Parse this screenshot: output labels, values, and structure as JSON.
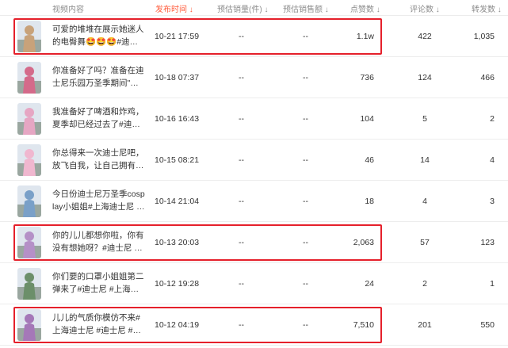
{
  "header": {
    "video_content": "视频内容",
    "publish_time": "发布时间",
    "est_sales": "预估销量(件)",
    "est_amount": "预估销售额",
    "likes": "点赞数",
    "comments": "评论数",
    "shares": "转发数"
  },
  "rows": [
    {
      "title": "可爱的堆堆在展示她迷人的电臀舞🤩🤩🤩#迪…",
      "time": "10-21 17:59",
      "sales": "--",
      "amount": "--",
      "likes": "1.1w",
      "comments": "422",
      "shares": "1,035",
      "highlighted": true,
      "thumb_color": "#c8a27a"
    },
    {
      "title": "你准备好了吗？准备在迪士尼乐园万圣季期间\"…",
      "time": "10-18 07:37",
      "sales": "--",
      "amount": "--",
      "likes": "736",
      "comments": "124",
      "shares": "466",
      "highlighted": false,
      "thumb_color": "#d46a8a"
    },
    {
      "title": "我准备好了啤酒和炸鸡，夏季却已经过去了#迪…",
      "time": "10-16 16:43",
      "sales": "--",
      "amount": "--",
      "likes": "104",
      "comments": "5",
      "shares": "2",
      "highlighted": false,
      "thumb_color": "#e6a6c3"
    },
    {
      "title": "你总得来一次迪士尼吧，放飞自我，让自己拥有…",
      "time": "10-15 08:21",
      "sales": "--",
      "amount": "--",
      "likes": "46",
      "comments": "14",
      "shares": "4",
      "highlighted": false,
      "thumb_color": "#f0b7cf"
    },
    {
      "title": "今日份迪士尼万圣季cosplay小姐姐#上海迪士尼 …",
      "time": "10-14 21:04",
      "sales": "--",
      "amount": "--",
      "likes": "18",
      "comments": "4",
      "shares": "3",
      "highlighted": false,
      "thumb_color": "#7aa0c8"
    },
    {
      "title": "你的儿儿都想你啦，你有没有想她呀？#迪士尼 …",
      "time": "10-13 20:03",
      "sales": "--",
      "amount": "--",
      "likes": "2,063",
      "comments": "57",
      "shares": "123",
      "highlighted": true,
      "thumb_color": "#b590c7"
    },
    {
      "title": "你们要的口罩小姐姐第二弹来了#迪士尼 #上海…",
      "time": "10-12 19:28",
      "sales": "--",
      "amount": "--",
      "likes": "24",
      "comments": "2",
      "shares": "1",
      "highlighted": false,
      "thumb_color": "#6c8f6a"
    },
    {
      "title": "儿儿的气质你模仿不来#上海迪士尼 #迪士尼 #…",
      "time": "10-12 04:19",
      "sales": "--",
      "amount": "--",
      "likes": "7,510",
      "comments": "201",
      "shares": "550",
      "highlighted": true,
      "thumb_color": "#a578b8"
    }
  ],
  "colors": {
    "active_sort": "#ff5b3a",
    "highlight_border": "#e5202b",
    "header_text": "#8c8c8c"
  }
}
